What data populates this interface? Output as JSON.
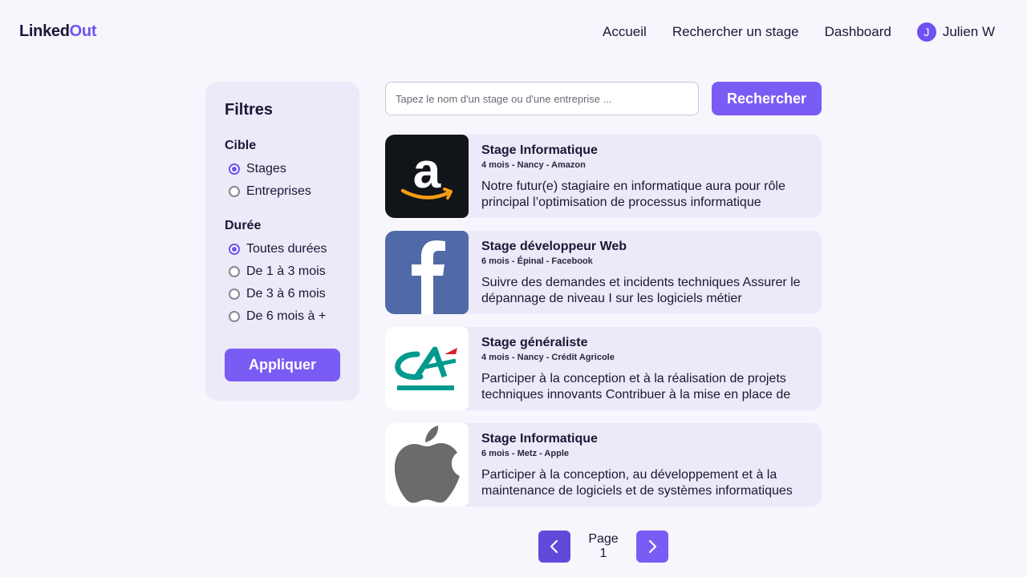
{
  "header": {
    "logo_part1": "Linked",
    "logo_part2": "Out",
    "nav": [
      "Accueil",
      "Rechercher un stage",
      "Dashboard"
    ],
    "user": {
      "initial": "J",
      "name": "Julien W"
    }
  },
  "filters": {
    "title": "Filtres",
    "cible": {
      "label": "Cible",
      "options": [
        "Stages",
        "Entreprises"
      ],
      "selected": "Stages"
    },
    "duree": {
      "label": "Durée",
      "options": [
        "Toutes durées",
        "De 1 à 3 mois",
        "De 3 à 6 mois",
        "De 6 mois à +"
      ],
      "selected": "Toutes durées"
    },
    "apply_label": "Appliquer"
  },
  "search": {
    "placeholder": "Tapez le nom d'un stage ou d'une entreprise ...",
    "value": "",
    "button_label": "Rechercher"
  },
  "results": [
    {
      "title": "Stage Informatique",
      "meta": "4 mois - Nancy - Amazon",
      "description": "Notre futur(e) stagiaire en informatique aura pour rôle principal l’optimisation de processus informatique",
      "logo": "amazon-logo",
      "logo_bg": "#111418"
    },
    {
      "title": "Stage développeur Web",
      "meta": "6 mois - Épinal - Facebook",
      "description": "Suivre des demandes et incidents techniques Assurer le dépannage de niveau I sur les logiciels métier",
      "logo": "facebook-logo",
      "logo_bg": "#4f6aa6"
    },
    {
      "title": "Stage généraliste",
      "meta": "4 mois - Nancy - Crédit Agricole",
      "description": "Participer à la conception et à la réalisation de projets techniques innovants Contribuer à la mise en place de",
      "logo": "credit-agricole-logo",
      "logo_bg": "#ffffff"
    },
    {
      "title": "Stage Informatique",
      "meta": "6 mois - Metz - Apple",
      "description": "Participer à la conception, au développement et à la maintenance de logiciels et de systèmes informatiques",
      "logo": "apple-logo",
      "logo_bg": "#ffffff"
    }
  ],
  "pagination": {
    "label": "Page 1",
    "prev_icon": "chevron-left-icon",
    "next_icon": "chevron-right-icon"
  },
  "colors": {
    "accent": "#7a5cf5",
    "background": "#f7f6fd",
    "card": "#ece9f8"
  }
}
